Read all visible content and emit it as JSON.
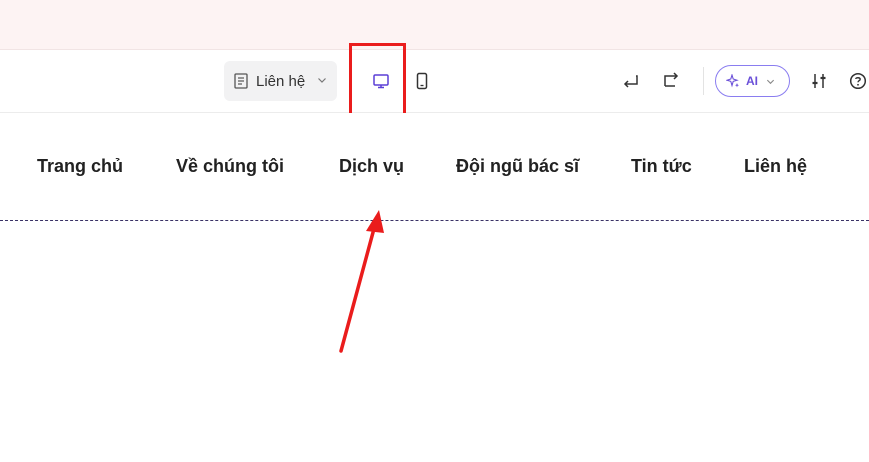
{
  "toolbar": {
    "page_select": {
      "label": "Liên hệ",
      "icon": "page-icon"
    },
    "view_modes": {
      "desktop_icon": "desktop-icon",
      "mobile_icon": "mobile-icon",
      "active": "desktop"
    },
    "undo_icon": "undo-icon",
    "redo_icon": "redo-icon",
    "ai_button": {
      "label": "AI",
      "icon": "sparkle-icon"
    },
    "settings_icon": "sliders-icon",
    "help_icon": "help-icon"
  },
  "nav_menu": {
    "items": [
      {
        "label": "Trang chủ"
      },
      {
        "label": "Về chúng tôi"
      },
      {
        "label": "Dịch vụ"
      },
      {
        "label": "Đội ngũ bác sĩ"
      },
      {
        "label": "Tin tức"
      },
      {
        "label": "Liên hệ"
      }
    ]
  },
  "annotation": {
    "highlight_color": "#ea1c1c",
    "arrow_color": "#ea1c1c"
  },
  "colors": {
    "accent": "#6a4fd8",
    "notice_bg": "#fdf3f3",
    "divider": "#3a3266"
  }
}
